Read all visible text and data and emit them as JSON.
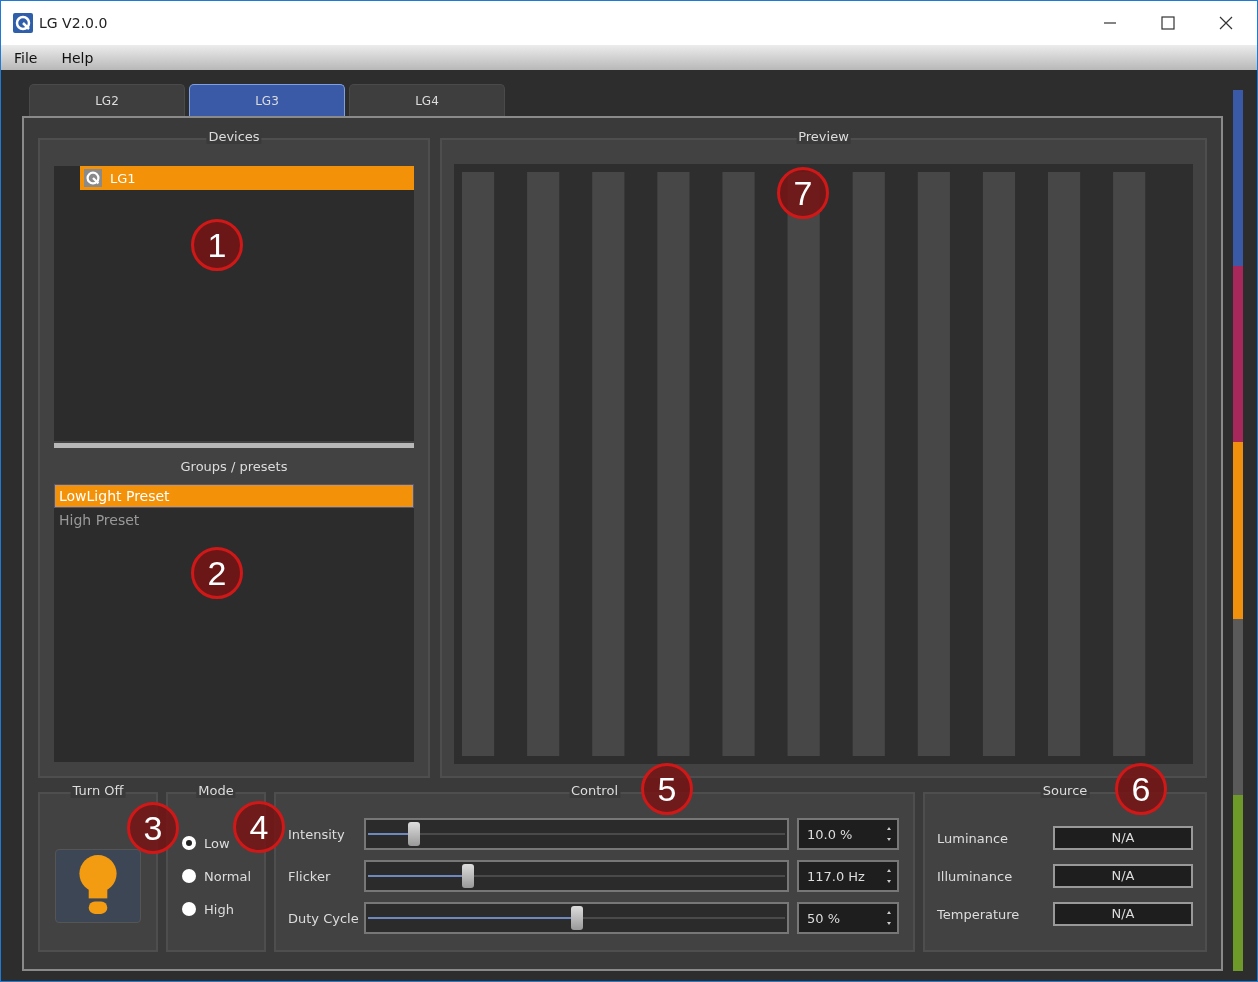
{
  "window": {
    "title": "LG V2.0.0"
  },
  "menu": [
    "File",
    "Help"
  ],
  "tabs": [
    {
      "label": "LG2",
      "selected": false
    },
    {
      "label": "LG3",
      "selected": true
    },
    {
      "label": "LG4",
      "selected": false
    }
  ],
  "devices": {
    "title": "Devices",
    "items": [
      {
        "label": "LG1",
        "selected": true
      }
    ]
  },
  "groups": {
    "title": "Groups / presets",
    "items": [
      {
        "label": "LowLight Preset",
        "selected": true
      },
      {
        "label": "High Preset",
        "selected": false
      }
    ]
  },
  "preview": {
    "title": "Preview"
  },
  "turn_off": {
    "title": "Turn Off"
  },
  "mode": {
    "title": "Mode",
    "options": [
      {
        "label": "Low",
        "selected": true
      },
      {
        "label": "Normal",
        "selected": false
      },
      {
        "label": "High",
        "selected": false
      }
    ]
  },
  "control": {
    "title": "Control",
    "rows": [
      {
        "label": "Intensity",
        "level": 0.11,
        "value": "10.0 %"
      },
      {
        "label": "Flicker",
        "level": 0.24,
        "value": "117.0 Hz"
      },
      {
        "label": "Duty Cycle",
        "level": 0.5,
        "value": "50 %"
      }
    ]
  },
  "source": {
    "title": "Source",
    "rows": [
      {
        "label": "Luminance",
        "value": "N/A"
      },
      {
        "label": "Illuminance",
        "value": "N/A"
      },
      {
        "label": "Temperature",
        "value": "N/A"
      }
    ]
  },
  "side_strip": [
    {
      "color": "#3a5aa8"
    },
    {
      "color": "#a8285c"
    },
    {
      "color": "#f0900c"
    },
    {
      "color": "#5a5a5a"
    },
    {
      "color": "#6e9a2a"
    }
  ],
  "callouts": [
    "1",
    "2",
    "3",
    "4",
    "5",
    "6",
    "7"
  ]
}
